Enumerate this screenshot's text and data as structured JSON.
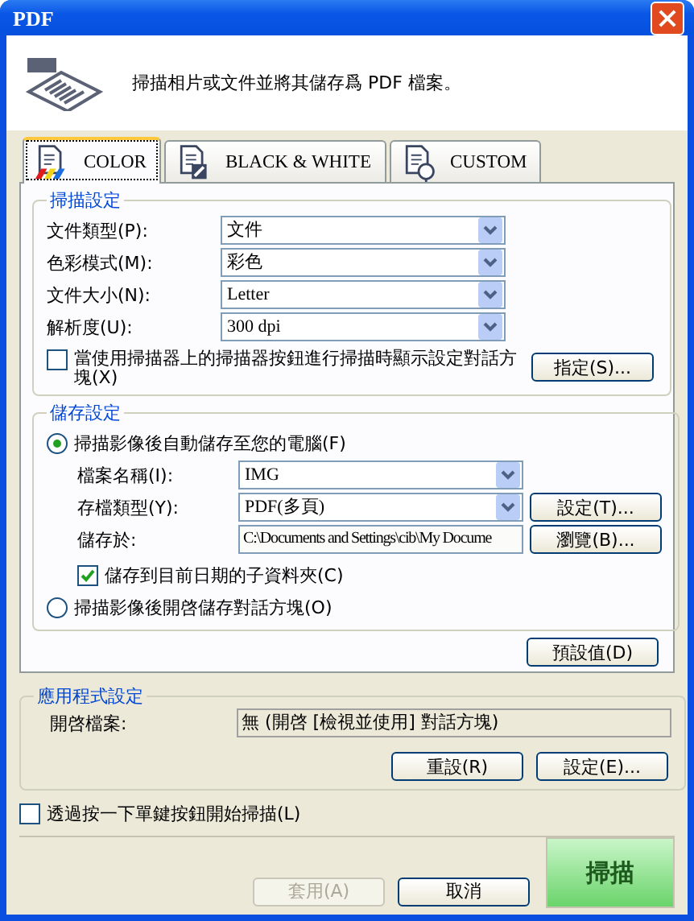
{
  "window": {
    "title": "PDF"
  },
  "header": {
    "text": "掃描相片或文件並將其儲存爲 PDF 檔案。"
  },
  "tabs": [
    {
      "label": "COLOR",
      "kind": "color",
      "selected": true
    },
    {
      "label": "BLACK & WHITE",
      "kind": "bw",
      "selected": false
    },
    {
      "label": "CUSTOM",
      "kind": "custom",
      "selected": false
    }
  ],
  "scan_settings": {
    "title": "掃描設定",
    "fields": [
      {
        "label": "文件類型(P):",
        "value": "文件"
      },
      {
        "label": "色彩模式(M):",
        "value": "彩色"
      },
      {
        "label": "文件大小(N):",
        "value": "Letter"
      },
      {
        "label": "解析度(U):",
        "value": "300 dpi"
      }
    ],
    "checkbox": {
      "label": "當使用掃描器上的掃描器按鈕進行掃描時顯示設定對話方塊(X)",
      "checked": false
    },
    "button": "指定(S)..."
  },
  "save_settings": {
    "title": "儲存設定",
    "options": [
      {
        "label": "掃描影像後自動儲存至您的電腦(F)",
        "selected": true
      },
      {
        "label": "掃描影像後開啓儲存對話方塊(O)",
        "selected": false
      }
    ],
    "file_name": {
      "label": "檔案名稱(I):",
      "value": "IMG"
    },
    "file_type": {
      "label": "存檔類型(Y):",
      "value": "PDF(多頁)",
      "button": "設定(T)..."
    },
    "save_in": {
      "label": "儲存於:",
      "value": "C:\\Documents and Settings\\cib\\My Docume",
      "button": "瀏覽(B)..."
    },
    "subfolder": {
      "label": "儲存到目前日期的子資料夾(C)",
      "checked": true
    }
  },
  "default_button": "預設值(D)",
  "app_settings": {
    "title": "應用程式設定",
    "open_file": {
      "label": "開啓檔案:",
      "value": "無 (開啓 [檢視並使用] 對話方塊)"
    },
    "buttons": [
      "重設(R)",
      "設定(E)..."
    ]
  },
  "one_touch": {
    "label": "透過按一下單鍵按鈕開始掃描(L)",
    "checked": false
  },
  "footer": {
    "buttons": [
      {
        "label": "套用(A)",
        "disabled": true
      },
      {
        "label": "取消",
        "disabled": false
      }
    ],
    "scan_button": "掃描"
  }
}
